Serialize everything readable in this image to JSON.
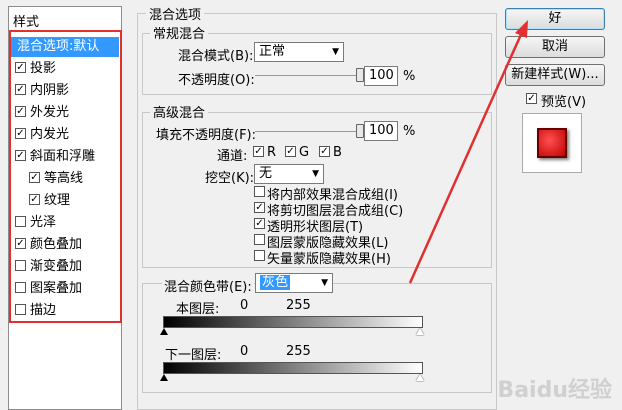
{
  "styles": {
    "header": "样式",
    "selected": "混合选项:默认",
    "items": [
      {
        "label": "投影",
        "checked": true
      },
      {
        "label": "内阴影",
        "checked": true
      },
      {
        "label": "外发光",
        "checked": true
      },
      {
        "label": "内发光",
        "checked": true
      },
      {
        "label": "斜面和浮雕",
        "checked": true
      },
      {
        "label": "等高线",
        "checked": true
      },
      {
        "label": "纹理",
        "checked": true
      },
      {
        "label": "光泽",
        "checked": false
      },
      {
        "label": "颜色叠加",
        "checked": true
      },
      {
        "label": "渐变叠加",
        "checked": false
      },
      {
        "label": "图案叠加",
        "checked": false
      },
      {
        "label": "描边",
        "checked": false
      }
    ]
  },
  "blend": {
    "title": "混合选项",
    "general": {
      "title": "常规混合",
      "mode_label": "混合模式(B):",
      "mode_value": "正常",
      "opacity_label": "不透明度(O):",
      "opacity_value": "100",
      "opacity_percent": 100,
      "unit": "%"
    },
    "advanced": {
      "title": "高级混合",
      "fill_label": "填充不透明度(F):",
      "fill_value": "100",
      "fill_percent": 100,
      "unit": "%",
      "channels_label": "通道:",
      "channels": [
        "R",
        "G",
        "B"
      ],
      "knockout_label": "挖空(K):",
      "knockout_value": "无",
      "options": [
        {
          "label": "将内部效果混合成组(I)",
          "checked": false
        },
        {
          "label": "将剪切图层混合成组(C)",
          "checked": true
        },
        {
          "label": "透明形状图层(T)",
          "checked": true
        },
        {
          "label": "图层蒙版隐藏效果(L)",
          "checked": false
        },
        {
          "label": "矢量蒙版隐藏效果(H)",
          "checked": false
        }
      ]
    },
    "blend_if": {
      "label": "混合颜色带(E):",
      "value": "灰色",
      "this_layer_label": "本图层:",
      "this_layer_min": "0",
      "this_layer_max": "255",
      "underlying_label": "下一图层:",
      "underlying_min": "0",
      "underlying_max": "255"
    }
  },
  "buttons": {
    "ok": "好",
    "cancel": "取消",
    "new_style": "新建样式(W)...",
    "preview": "预览(V)",
    "preview_checked": true
  },
  "watermark": "Baidu经验",
  "colors": {
    "selection": "#3399ff",
    "annotation": "#e03030",
    "preview_red": "#e01010"
  }
}
